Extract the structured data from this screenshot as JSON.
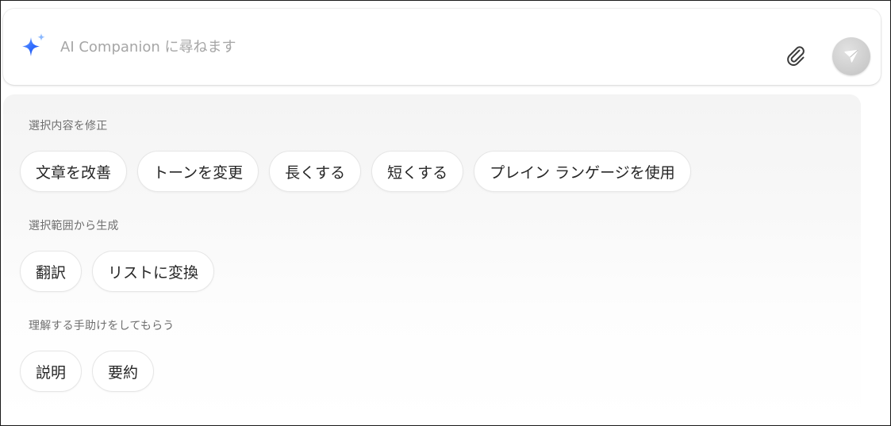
{
  "input": {
    "placeholder": "AI Companion に尋ねます",
    "value": ""
  },
  "icons": {
    "leading": "sparkle-icon",
    "attach": "paperclip-icon",
    "send": "send-arrow-icon"
  },
  "colors": {
    "sparkle_blue": "#2f6bff",
    "sparkle_light": "#7fb2ff",
    "send_button": "#cbcbcb",
    "chip_text": "#262626",
    "section_title": "#6f6f6f"
  },
  "sections": [
    {
      "title": "選択内容を修正",
      "chips": [
        "文章を改善",
        "トーンを変更",
        "長くする",
        "短くする",
        "プレイン ランゲージを使用"
      ]
    },
    {
      "title": "選択範囲から生成",
      "chips": [
        "翻訳",
        "リストに変換"
      ]
    },
    {
      "title": "理解する手助けをしてもらう",
      "chips": [
        "説明",
        "要約"
      ]
    }
  ]
}
